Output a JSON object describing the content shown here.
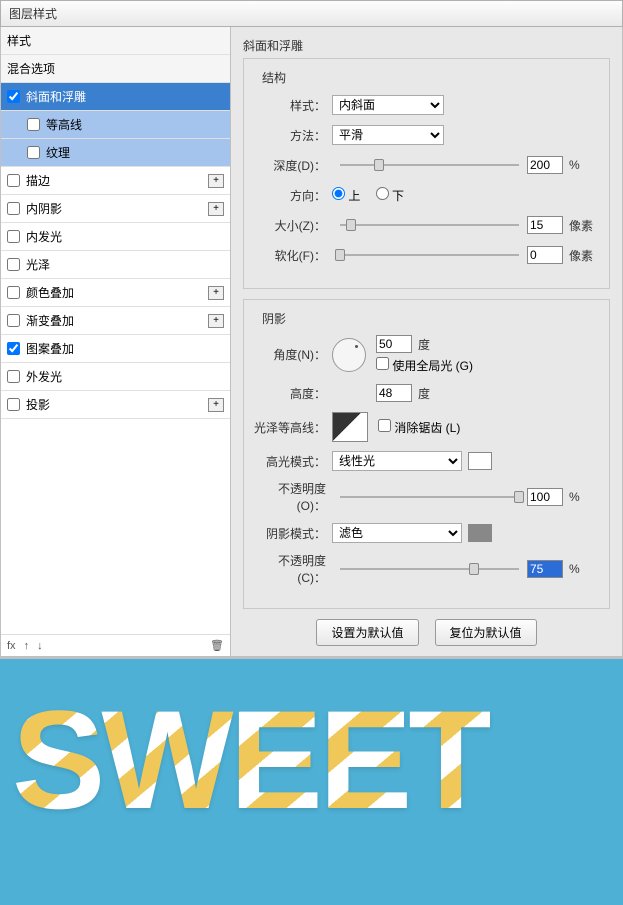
{
  "title": "图层样式",
  "sidebar": {
    "header1": "样式",
    "header2": "混合选项",
    "items": [
      {
        "label": "斜面和浮雕",
        "checked": true,
        "selected": true,
        "expandable": false
      },
      {
        "label": "等高线",
        "checked": false,
        "sub": true,
        "subsel": true
      },
      {
        "label": "纹理",
        "checked": false,
        "sub": true,
        "subsel": true
      },
      {
        "label": "描边",
        "checked": false,
        "expandable": true
      },
      {
        "label": "内阴影",
        "checked": false,
        "expandable": true
      },
      {
        "label": "内发光",
        "checked": false
      },
      {
        "label": "光泽",
        "checked": false
      },
      {
        "label": "颜色叠加",
        "checked": false,
        "expandable": true
      },
      {
        "label": "渐变叠加",
        "checked": false,
        "expandable": true
      },
      {
        "label": "图案叠加",
        "checked": true
      },
      {
        "label": "外发光",
        "checked": false
      },
      {
        "label": "投影",
        "checked": false,
        "expandable": true
      }
    ],
    "footer_fx": "fx"
  },
  "panel": {
    "group1_title": "斜面和浮雕",
    "struct_title": "结构",
    "style_label": "样式：",
    "style_value": "内斜面",
    "method_label": "方法：",
    "method_value": "平滑",
    "depth_label": "深度(D)：",
    "depth_value": "200",
    "pct": "%",
    "dir_label": "方向：",
    "dir_up": "上",
    "dir_down": "下",
    "size_label": "大小(Z)：",
    "size_value": "15",
    "px": "像素",
    "soft_label": "软化(F)：",
    "soft_value": "0",
    "shadow_title": "阴影",
    "angle_label": "角度(N)：",
    "angle_value": "50",
    "deg": "度",
    "global_label": "使用全局光 (G)",
    "altitude_label": "高度：",
    "altitude_value": "48",
    "gloss_label": "光泽等高线：",
    "antialias_label": "消除锯齿 (L)",
    "hilite_mode_label": "高光模式：",
    "hilite_mode_value": "线性光",
    "hilite_op_label": "不透明度(O)：",
    "hilite_op_value": "100",
    "shadow_mode_label": "阴影模式：",
    "shadow_mode_value": "滤色",
    "shadow_op_label": "不透明度(C)：",
    "shadow_op_value": "75",
    "btn_default": "设置为默认值",
    "btn_reset": "复位为默认值"
  },
  "preview_text": "SWEET"
}
